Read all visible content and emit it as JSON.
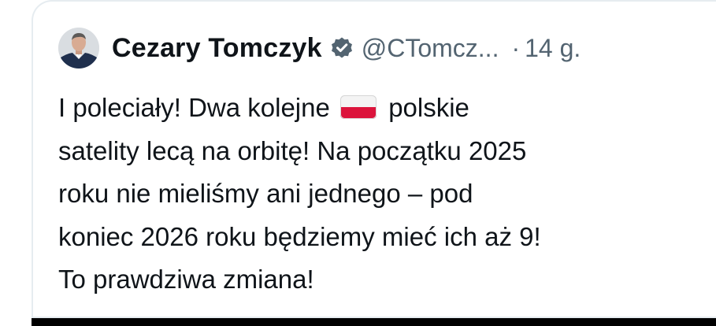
{
  "tweet": {
    "author": {
      "display_name": "Cezary Tomczyk",
      "handle": "@CTomcz...",
      "verified": true,
      "avatar": "avatar-photo"
    },
    "separator": "·",
    "time": "14 g.",
    "text_lines": {
      "line1_before": "I poleciały! Dwa kolejne",
      "line1_after": "polskie",
      "line2": "satelity lecą na orbitę! Na początku 2025",
      "line3": "roku nie mieliśmy ani jednego – pod",
      "line4": "koniec 2026 roku będziemy mieć ich aż 9!",
      "line5": "To prawdziwa zmiana!"
    },
    "emoji": "poland-flag-icon"
  },
  "colors": {
    "text_primary": "#0f1419",
    "text_secondary": "#536471",
    "border": "#e6ecf0",
    "verified_badge": "#536471",
    "flag_white": "#f4f4f4",
    "flag_red": "#dc143c"
  }
}
